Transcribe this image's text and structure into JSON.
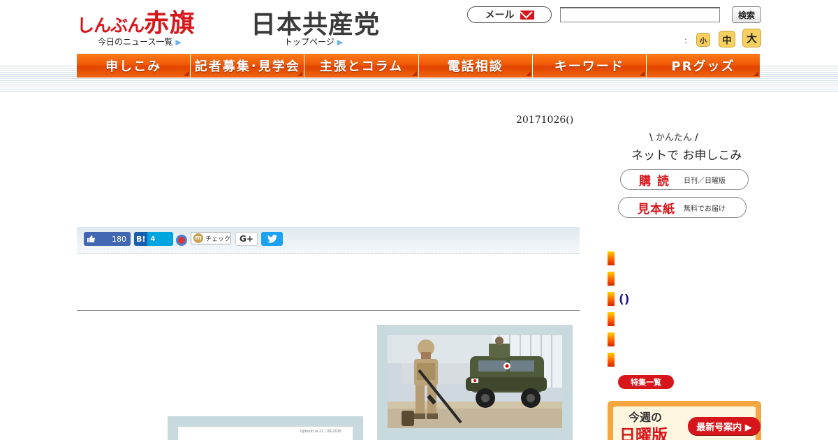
{
  "header": {
    "akahata_logo_small": "しんぶん",
    "akahata_logo_big": "赤旗",
    "jcp_logo": "日本共産党",
    "news_list_link": "今日のニュース一覧",
    "top_page_link": "トップページ",
    "arrow": "▶",
    "mail_label": "メール",
    "search_placeholder": "",
    "search_button": "検索",
    "font_size_label": ":",
    "font_small": "小",
    "font_medium": "中",
    "font_large": "大"
  },
  "nav": {
    "items": [
      "申しこみ",
      "記者募集･見学会",
      "主張とコラム",
      "電話相談",
      "キーワード",
      "PRグッズ"
    ]
  },
  "main": {
    "date": "20171026()",
    "share": {
      "fb_count": "180",
      "hatena_label": "B!",
      "hatena_count": "4",
      "mixi_label": "チェック",
      "gplus_label": "G+"
    },
    "photo2_caption": "Djibouti le 21 / 06/2016"
  },
  "sidebar": {
    "net_kantan": "かんたん",
    "net_main": "ネットで お申しこみ",
    "subscribe_big": "購読",
    "subscribe_small": "日刊／日曜版",
    "sample_big": "見本紙",
    "sample_small": "無料でお届け",
    "paren_link": "()",
    "feature_list": "特集一覧",
    "sunday_line1": "今週の",
    "sunday_line2": "日曜版",
    "sunday_button": "最新号案内 ▶"
  },
  "colors": {
    "brand_red": "#d7161b",
    "nav_orange": "#f05a05",
    "link_blue": "#1a1a9a"
  }
}
